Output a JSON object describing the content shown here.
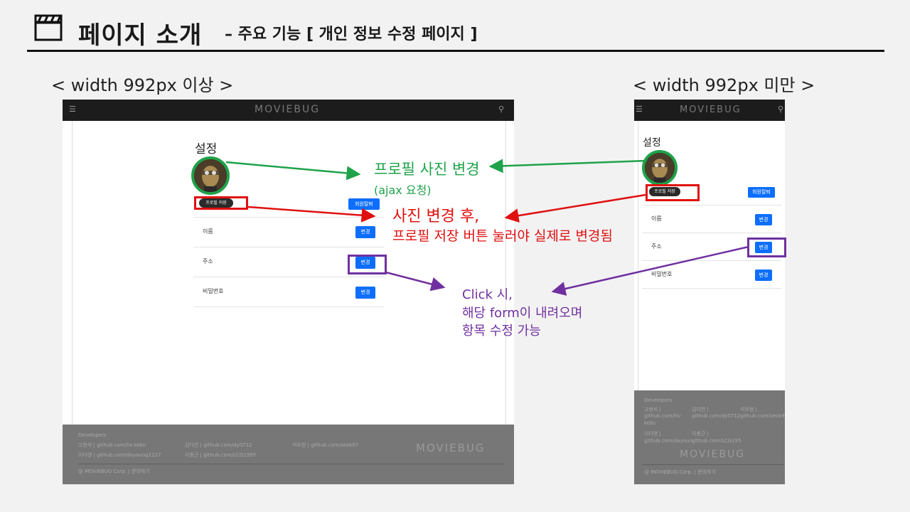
{
  "slide": {
    "title": "페이지 소개",
    "subtitle": "– 주요 기능 [ 개인 정보 수정 페이지 ]",
    "icon": "clapperboard-icon"
  },
  "sections": {
    "wide_label": "< width 992px 이상 >",
    "narrow_label": "< width 992px 미만 >"
  },
  "app": {
    "logo": "MOVIEBUG",
    "menu_icon": "hamburger-icon",
    "search_icon": "search-icon",
    "settings_title": "설정",
    "save_photo_button": "프로필 저장",
    "withdraw_button": "회원탈퇴",
    "rows": [
      {
        "label": "이름",
        "button": "변경"
      },
      {
        "label": "주소",
        "button": "변경"
      },
      {
        "label": "비밀번호",
        "button": "변경"
      }
    ],
    "footer": {
      "heading": "Developers",
      "devs_wide": [
        "고현석 | github.com/hs-keko",
        "김다연 | github.com/dy0712",
        "석우현 | github.com/seok97",
        "이다영 | github.com/dayoung1227",
        "이충근 | github.com/LCG1997"
      ],
      "devs_narrow": {
        "name1": "고현석 |",
        "link1a": "github.com/hs-",
        "link1b": "keko",
        "name2": "김다연 |",
        "link2": "github.com/dy0712",
        "name3": "석우현 |",
        "link3": "github.com/seok97",
        "name4": "이다영 |",
        "link4": "github.com/dayoun",
        "name5": "이충근 |",
        "link5": "github.com/LCG195"
      },
      "copyright": "@ MOVIEBUG Corp. | 문의하기"
    }
  },
  "annotations": {
    "photo_change": "프로필 사진 변경",
    "ajax": "(ajax 요청)",
    "after_photo": "사진 변경 후,",
    "after_photo_2": "프로필 저장 버튼 눌러야 실제로 변경됨",
    "click_1": "Click 시,",
    "click_2": "해당 form이 내려오며",
    "click_3": "항목 수정 가능"
  },
  "colors": {
    "green": "#1fa24a",
    "red": "#e01010",
    "purple": "#7030a0",
    "button_blue": "#0d6efd",
    "navbar": "#1c1c1c",
    "footer": "#777777"
  }
}
